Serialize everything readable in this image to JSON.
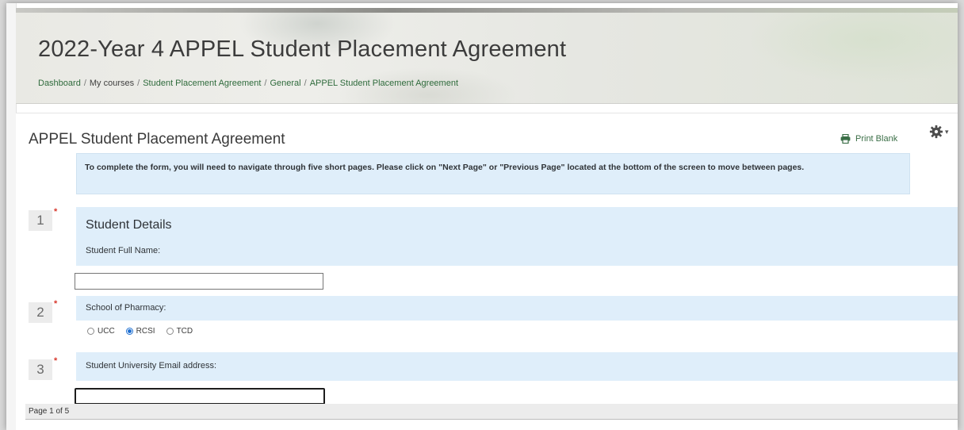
{
  "header": {
    "title": "2022-Year 4 APPEL Student Placement Agreement",
    "breadcrumb": [
      {
        "label": "Dashboard",
        "link": true
      },
      {
        "label": "My courses",
        "link": false
      },
      {
        "label": "Student Placement Agreement",
        "link": true
      },
      {
        "label": "General",
        "link": true
      },
      {
        "label": "APPEL Student Placement Agreement",
        "link": true
      }
    ]
  },
  "card": {
    "title": "APPEL Student Placement Agreement",
    "print_label": "Print Blank",
    "info_text": "To complete the form, you will need to navigate through five short pages. Please click on \"Next Page\" or \"Previous Page\" located at the bottom of the screen to move between pages."
  },
  "questions": [
    {
      "number": "1",
      "section_title": "Student Details",
      "label": "Student Full Name:",
      "value": ""
    },
    {
      "number": "2",
      "label": "School of Pharmacy:",
      "options": [
        "UCC",
        "RCSI",
        "TCD"
      ],
      "selected": "RCSI"
    },
    {
      "number": "3",
      "label": "Student University Email address:",
      "value": ""
    }
  ],
  "required_marker": "*",
  "pager": {
    "text": "Page 1 of 5"
  },
  "colors": {
    "accent_green": "#2f6b3c",
    "question_bg": "#dfeefa",
    "required": "#d7372c",
    "radio_selected": "#1e6fd1"
  },
  "icons": {
    "print": "printer-icon",
    "settings": "gear-icon"
  }
}
